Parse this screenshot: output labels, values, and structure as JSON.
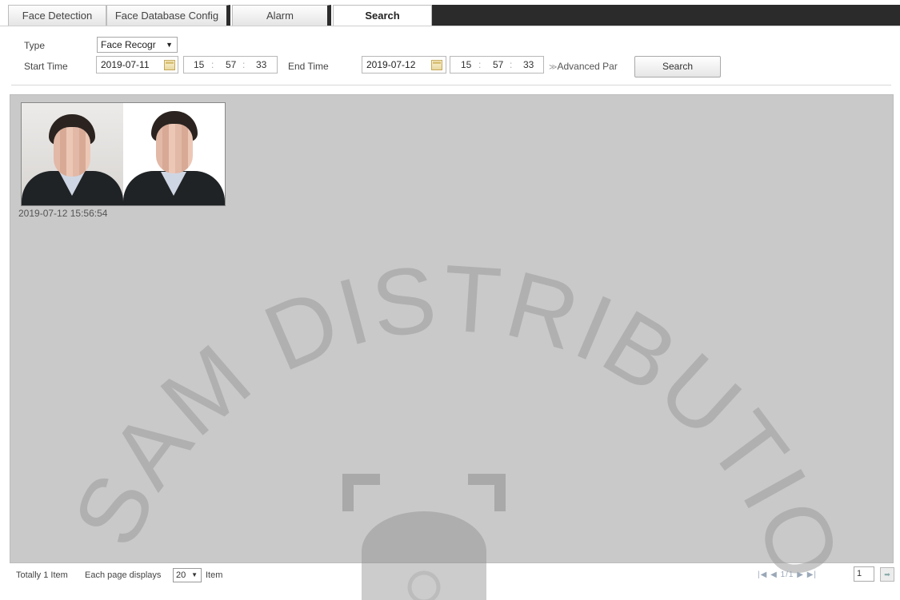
{
  "tabs": [
    {
      "label": "Face Detection",
      "active": false
    },
    {
      "label": "Face Database Config",
      "active": false
    },
    {
      "label": "Alarm",
      "active": false
    },
    {
      "label": "Search",
      "active": true
    }
  ],
  "form": {
    "type_label": "Type",
    "type_value": "Face Recogr",
    "start_label": "Start Time",
    "start_date": "2019-07-11",
    "start_hour": "15",
    "start_min": "57",
    "start_sec": "33",
    "end_label": "End Time",
    "end_date": "2019-07-12",
    "end_hour": "15",
    "end_min": "57",
    "end_sec": "33",
    "advanced_label": "Advanced Par",
    "search_button": "Search"
  },
  "results": {
    "items": [
      {
        "timestamp": "2019-07-12 15:56:54"
      }
    ]
  },
  "footer": {
    "totally": "Totally 1 Item",
    "each_page": "Each page displays",
    "per_page": "20",
    "item": "Item",
    "page_info": "1/1",
    "page_input": "1"
  },
  "watermark": {
    "text": "SAM DISTRIBUTION"
  },
  "colors": {
    "tab_bar_dark": "#2b2b2b",
    "results_bg": "#c9c9c9",
    "watermark": "#9a9a9a"
  },
  "icons": {
    "calendar": "calendar-icon",
    "advanced": "double-chevron-down-icon",
    "dropdown": "dropdown-arrow-icon",
    "first_page": "first-page-icon",
    "prev_page": "prev-page-icon",
    "next_page": "next-page-icon",
    "last_page": "last-page-icon",
    "go": "go-arrow-icon"
  }
}
